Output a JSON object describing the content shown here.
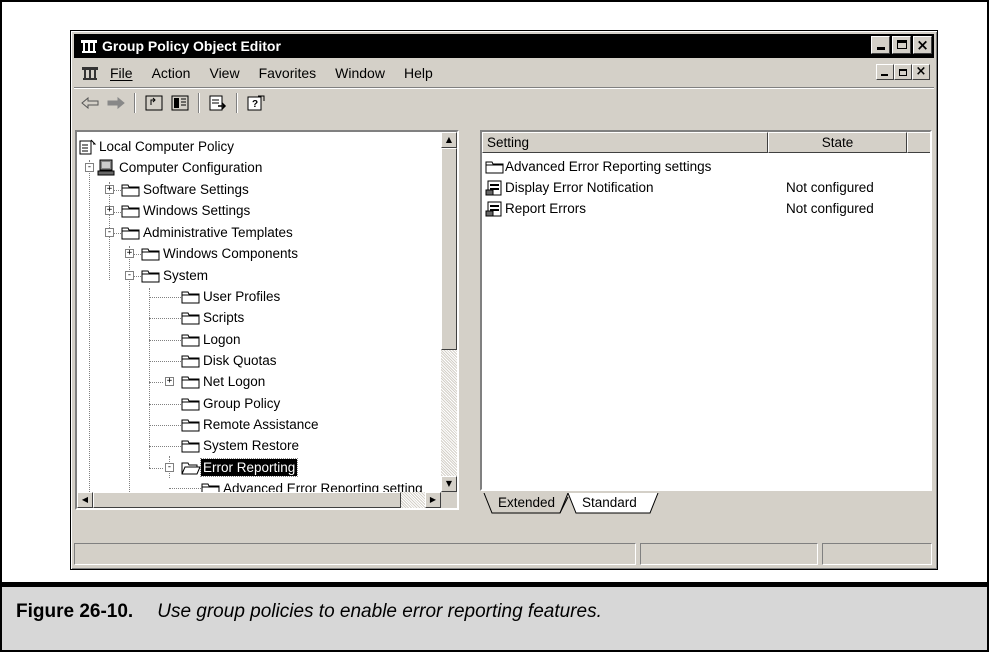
{
  "window": {
    "title": "Group Policy Object Editor"
  },
  "menu": {
    "items": [
      "File",
      "Action",
      "View",
      "Favorites",
      "Window",
      "Help"
    ]
  },
  "toolbar": {
    "buttons": [
      "back-icon",
      "forward-icon",
      "up-one-level-icon",
      "show-hide-tree-icon",
      "export-list-icon",
      "help-icon"
    ]
  },
  "tree": {
    "nodes": [
      {
        "label": "Local Computer Policy",
        "icon": "policy-icon"
      },
      {
        "label": "Computer Configuration",
        "icon": "computer-icon",
        "expander": "-"
      },
      {
        "label": "Software Settings",
        "icon": "folder-icon",
        "expander": "+"
      },
      {
        "label": "Windows Settings",
        "icon": "folder-icon",
        "expander": "+"
      },
      {
        "label": "Administrative Templates",
        "icon": "folder-icon",
        "expander": "-"
      },
      {
        "label": "Windows Components",
        "icon": "folder-icon",
        "expander": "+"
      },
      {
        "label": "System",
        "icon": "folder-icon",
        "expander": "-"
      },
      {
        "label": "User Profiles",
        "icon": "folder-icon"
      },
      {
        "label": "Scripts",
        "icon": "folder-icon"
      },
      {
        "label": "Logon",
        "icon": "folder-icon"
      },
      {
        "label": "Disk Quotas",
        "icon": "folder-icon"
      },
      {
        "label": "Net Logon",
        "icon": "folder-icon",
        "expander": "+"
      },
      {
        "label": "Group Policy",
        "icon": "folder-icon"
      },
      {
        "label": "Remote Assistance",
        "icon": "folder-icon"
      },
      {
        "label": "System Restore",
        "icon": "folder-icon"
      },
      {
        "label": "Error Reporting",
        "icon": "open-folder-icon",
        "expander": "-",
        "selected": true
      },
      {
        "label": "Advanced Error Reporting setting",
        "icon": "folder-icon"
      }
    ]
  },
  "list": {
    "columns": [
      "Setting",
      "State"
    ],
    "rows": [
      {
        "setting": "Advanced Error Reporting settings",
        "state": "",
        "icon": "folder-icon"
      },
      {
        "setting": "Display Error Notification",
        "state": "Not configured",
        "icon": "policy-setting-icon"
      },
      {
        "setting": "Report Errors",
        "state": "Not configured",
        "icon": "policy-setting-icon"
      }
    ]
  },
  "tabs": {
    "extended": "Extended",
    "standard": "Standard",
    "active": "Standard"
  },
  "caption": {
    "number": "Figure 26-10.",
    "text": "Use group policies to enable error reporting features."
  }
}
